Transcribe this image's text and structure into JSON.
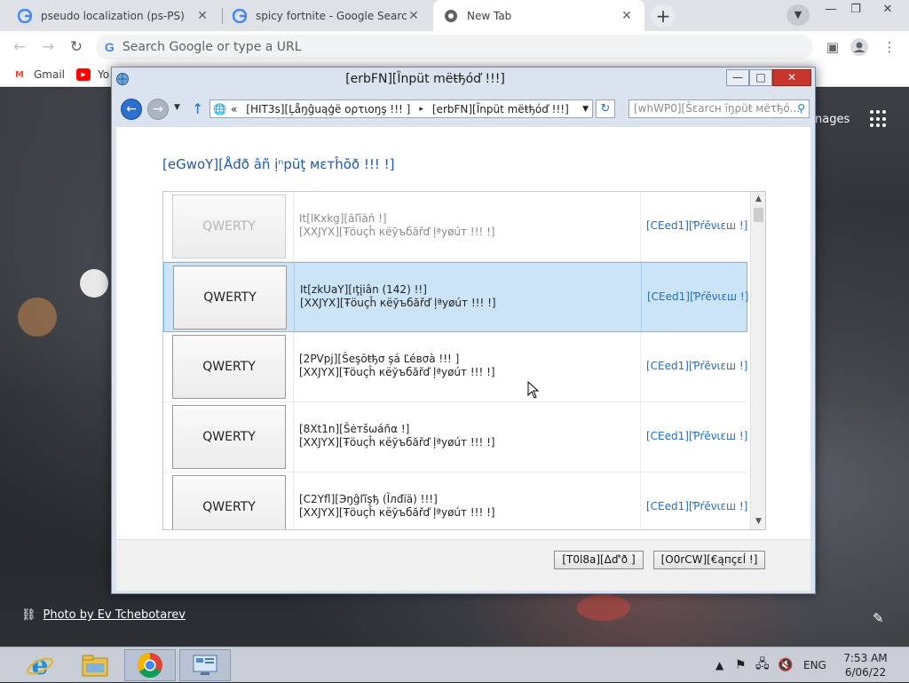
{
  "browser": {
    "tabs": [
      {
        "title": "pseudo localization (ps-PS)",
        "active": false
      },
      {
        "title": "spicy fortnite - Google Search",
        "active": false
      },
      {
        "title": "New Tab",
        "active": true
      }
    ],
    "omnibox_placeholder": "Search Google or type a URL",
    "bookmarks": [
      {
        "label": "Gmail"
      },
      {
        "label": "Yo"
      }
    ]
  },
  "newtab_page": {
    "images_link": "nages",
    "photo_credit": "Photo by Ev Tchebotarev"
  },
  "dialog": {
    "title": "[erbFN][Ȉnpüt mëŧђóď !!!]",
    "address_path": {
      "prefix": "«",
      "segment1": "[HIT3s][Ļåŋĝuąģë oρτιoŋş !!! ]",
      "separator": "▸",
      "segment2": "[erbFN][Ȉnpüt mëŧђóď !!!]"
    },
    "search_placeholder": "[whWP0][Šεarcн ïŋρüŧ мëτђó...",
    "heading": "[eGwoY][Åđð âñ ịⁿpŭţ мεтĥŏð !!! !]",
    "methods": [
      {
        "tile": "QWERTY",
        "line1": "It[lKxkg][ãľĭäń !]",
        "line2": "[XXJYX][Ŧöuçĥ кёўъбăřď ļªуøúт !!! !]",
        "preview": "[CEed1][Ƥŕĕνιεш !]",
        "state": "dim"
      },
      {
        "tile": "QWERTY",
        "line1": "It[zkUaY][ıţįiân (142) !!]",
        "line2": "[XXJYX][Ŧöuçĥ кёўъбăřď ļªуøúт !!! !]",
        "preview": "[CEed1][Ƥŕĕνιεш !]",
        "state": "selected"
      },
      {
        "tile": "QWERTY",
        "line1": "[2PVpj][Ŝeşōŧђσ şá Ľéвσà !!! ]",
        "line2": "[XXJYX][Ŧöuçĥ кёўъбăřď ļªуøúт !!! !]",
        "preview": "[CEed1][Ƥŕĕνιεш !]",
        "state": "normal"
      },
      {
        "tile": "QWERTY",
        "line1": "[8Xt1n][Šėтšωáñα !]",
        "line2": "[XXJYX][Ŧöuçĥ кёўъбăřď ļªуøúт !!! !]",
        "preview": "[CEed1][Ƥŕĕνιεш !]",
        "state": "normal"
      },
      {
        "tile": "QWERTY",
        "line1": "[C2Yfl][Эŋĝľĩşђ (Ĩлđïä) !!!]",
        "line2": "[XXJYX][Ŧöuçĥ кёўъбăřď ļªуøúт !!! !]",
        "preview": "[CEed1][Ƥŕĕνιεш !]",
        "state": "normal"
      }
    ],
    "add_button": "[T0l8a][Δď'ð ]",
    "cancel_button": "[O0rCW][€ąпçεĺ !]"
  },
  "taskbar": {
    "language": "ENG",
    "time": "7:53 AM",
    "date": "6/06/22"
  },
  "colors": {
    "selection_bg": "#cce4f7",
    "link_blue": "#1e6fc1",
    "heading_blue": "#1e5aa8",
    "close_red": "#c7352b"
  }
}
